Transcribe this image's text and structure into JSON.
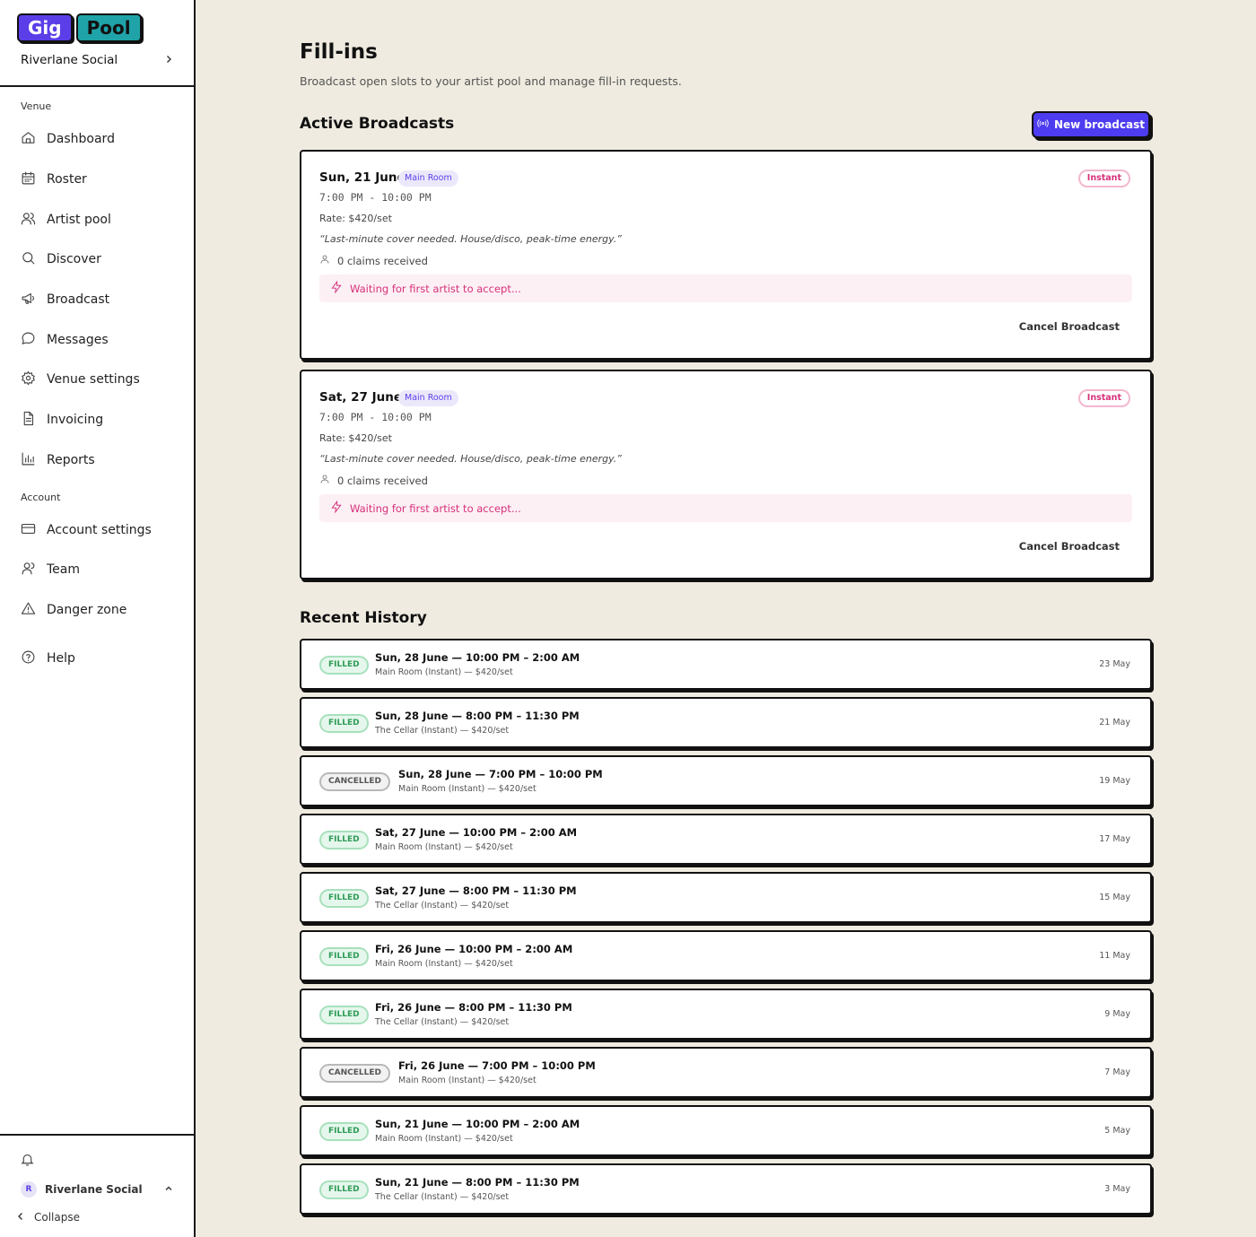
{
  "brand": {
    "logo_left": "Gig",
    "logo_right": "Pool"
  },
  "venue_switcher": {
    "name": "Riverlane Social"
  },
  "sidebar": {
    "venue_section": "Venue",
    "venue_items": [
      {
        "label": "Dashboard",
        "icon": "home-icon"
      },
      {
        "label": "Roster",
        "icon": "calendar-icon"
      },
      {
        "label": "Artist pool",
        "icon": "users-icon"
      },
      {
        "label": "Discover",
        "icon": "search-icon"
      },
      {
        "label": "Broadcast",
        "icon": "megaphone-icon"
      },
      {
        "label": "Messages",
        "icon": "message-icon"
      },
      {
        "label": "Venue settings",
        "icon": "gear-icon"
      },
      {
        "label": "Invoicing",
        "icon": "document-icon"
      },
      {
        "label": "Reports",
        "icon": "bar-chart-icon"
      }
    ],
    "account_section": "Account",
    "account_items": [
      {
        "label": "Account settings",
        "icon": "credit-card-icon"
      },
      {
        "label": "Team",
        "icon": "user-icon"
      },
      {
        "label": "Danger zone",
        "icon": "warning-icon"
      }
    ],
    "help": {
      "label": "Help",
      "icon": "help-icon"
    },
    "footer": {
      "avatar_initial": "R",
      "user_name": "Riverlane Social",
      "collapse_label": "Collapse"
    }
  },
  "main": {
    "title": "Fill-ins",
    "subtitle": "Broadcast open slots to your artist pool and manage fill-in requests.",
    "active_title": "Active Broadcasts",
    "new_broadcast_label": "New broadcast",
    "history_title": "Recent History"
  },
  "broadcasts": [
    {
      "date": "Sun, 21 June",
      "room": "Main Room",
      "type": "Instant",
      "time": "7:00 PM - 10:00 PM",
      "rate": "Rate: $420/set",
      "note": "“Last-minute cover needed. House/disco, peak-time energy.”",
      "claims": "0 claims received",
      "waiting": "Waiting for first artist to accept...",
      "cancel_label": "Cancel Broadcast"
    },
    {
      "date": "Sat, 27 June",
      "room": "Main Room",
      "type": "Instant",
      "time": "7:00 PM - 10:00 PM",
      "rate": "Rate: $420/set",
      "note": "“Last-minute cover needed. House/disco, peak-time energy.”",
      "claims": "0 claims received",
      "waiting": "Waiting for first artist to accept...",
      "cancel_label": "Cancel Broadcast"
    }
  ],
  "history": [
    {
      "status": "FILLED",
      "slot": "Sun, 28 June — 10:00 PM – 2:00 AM",
      "meta": "Main Room (Instant) — $420/set",
      "posted": "23 May"
    },
    {
      "status": "FILLED",
      "slot": "Sun, 28 June — 8:00 PM – 11:30 PM",
      "meta": "The Cellar (Instant) — $420/set",
      "posted": "21 May"
    },
    {
      "status": "CANCELLED",
      "slot": "Sun, 28 June — 7:00 PM – 10:00 PM",
      "meta": "Main Room (Instant) — $420/set",
      "posted": "19 May"
    },
    {
      "status": "FILLED",
      "slot": "Sat, 27 June — 10:00 PM – 2:00 AM",
      "meta": "Main Room (Instant) — $420/set",
      "posted": "17 May"
    },
    {
      "status": "FILLED",
      "slot": "Sat, 27 June — 8:00 PM – 11:30 PM",
      "meta": "The Cellar (Instant) — $420/set",
      "posted": "15 May"
    },
    {
      "status": "FILLED",
      "slot": "Fri, 26 June — 10:00 PM – 2:00 AM",
      "meta": "Main Room (Instant) — $420/set",
      "posted": "11 May"
    },
    {
      "status": "FILLED",
      "slot": "Fri, 26 June — 8:00 PM – 11:30 PM",
      "meta": "The Cellar (Instant) — $420/set",
      "posted": "9 May"
    },
    {
      "status": "CANCELLED",
      "slot": "Fri, 26 June — 7:00 PM – 10:00 PM",
      "meta": "Main Room (Instant) — $420/set",
      "posted": "7 May"
    },
    {
      "status": "FILLED",
      "slot": "Sun, 21 June — 10:00 PM – 2:00 AM",
      "meta": "Main Room (Instant) — $420/set",
      "posted": "5 May"
    },
    {
      "status": "FILLED",
      "slot": "Sun, 21 June — 8:00 PM – 11:30 PM",
      "meta": "The Cellar (Instant) — $420/set",
      "posted": "3 May"
    }
  ],
  "colors": {
    "accent": "#4d3cf0",
    "page_bg": "#efebe0",
    "filled": "#2e9b57",
    "pink": "#d6307a"
  }
}
